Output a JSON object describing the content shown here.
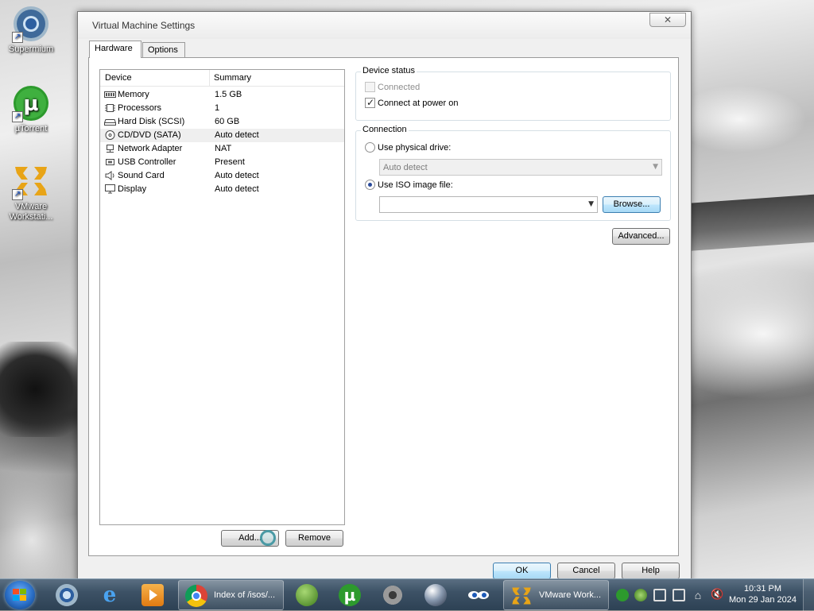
{
  "desktop": {
    "icons": [
      {
        "label": "Supermium",
        "icon": "supermium-icon"
      },
      {
        "label": "µTorrent",
        "icon": "utorrent-icon"
      },
      {
        "label": "VMware Workstati...",
        "icon": "vmware-icon"
      }
    ]
  },
  "window": {
    "title": "Virtual Machine Settings",
    "close_glyph": "✕",
    "tabs": [
      {
        "label": "Hardware",
        "active": true
      },
      {
        "label": "Options",
        "active": false
      }
    ]
  },
  "device_list": {
    "columns": [
      "Device",
      "Summary"
    ],
    "rows": [
      {
        "device": "Memory",
        "summary": "1.5 GB",
        "icon": "memory-icon"
      },
      {
        "device": "Processors",
        "summary": "1",
        "icon": "processor-icon"
      },
      {
        "device": "Hard Disk (SCSI)",
        "summary": "60 GB",
        "icon": "hard-disk-icon"
      },
      {
        "device": "CD/DVD (SATA)",
        "summary": "Auto detect",
        "icon": "cd-dvd-icon",
        "selected": true
      },
      {
        "device": "Network Adapter",
        "summary": "NAT",
        "icon": "network-adapter-icon"
      },
      {
        "device": "USB Controller",
        "summary": "Present",
        "icon": "usb-controller-icon"
      },
      {
        "device": "Sound Card",
        "summary": "Auto detect",
        "icon": "sound-card-icon"
      },
      {
        "device": "Display",
        "summary": "Auto detect",
        "icon": "display-icon"
      }
    ],
    "add_label": "Add...",
    "remove_label": "Remove"
  },
  "device_status": {
    "title": "Device status",
    "connected_label": "Connected",
    "connected_checked": false,
    "connect_power_label": "Connect at power on",
    "connect_power_checked": true
  },
  "connection": {
    "title": "Connection",
    "physical_label": "Use physical drive:",
    "physical_selected": false,
    "physical_value": "Auto detect",
    "iso_label": "Use ISO image file:",
    "iso_selected": true,
    "iso_value": "",
    "browse_label": "Browse..."
  },
  "advanced_label": "Advanced...",
  "dialog_buttons": {
    "ok": "OK",
    "cancel": "Cancel",
    "help": "Help"
  },
  "taskbar": {
    "items": [
      {
        "icon": "supermium-icon",
        "label": ""
      },
      {
        "icon": "internet-explorer-icon",
        "label": ""
      },
      {
        "icon": "media-player-icon",
        "label": ""
      },
      {
        "icon": "chrome-icon",
        "label": "Index of /isos/..."
      },
      {
        "icon": "windows-orb-icon",
        "label": ""
      },
      {
        "icon": "utorrent-icon",
        "label": ""
      },
      {
        "icon": "gear-icon",
        "label": ""
      },
      {
        "icon": "sphere-icon",
        "label": ""
      },
      {
        "icon": "eyes-icon",
        "label": ""
      },
      {
        "icon": "vmware-icon",
        "label": "VMware Work..."
      }
    ],
    "clock_time": "10:31 PM",
    "clock_date": "Mon 29 Jan 2024"
  },
  "colors": {
    "utorrent_green": "#2d9a2d",
    "vmware_orange": "#e8a417",
    "selection_blue": "#3c7fb1",
    "taskbar_blue": "#3d5266"
  }
}
